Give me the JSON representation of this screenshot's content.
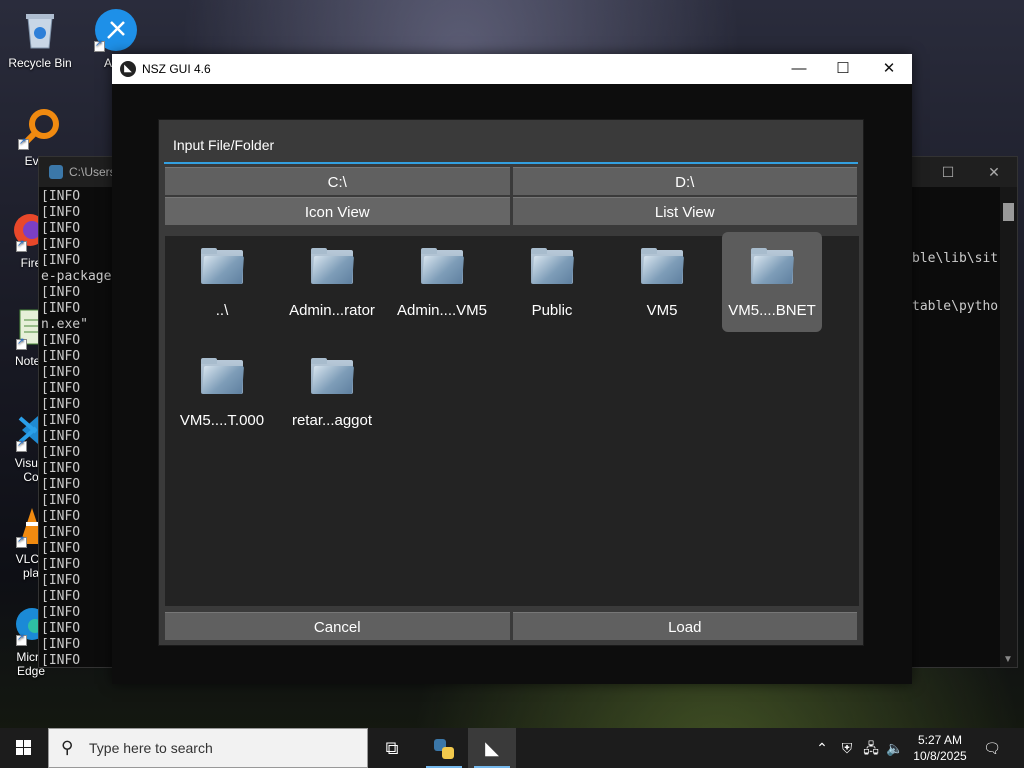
{
  "desktop": {
    "icons": [
      {
        "label": "Recycle Bin"
      },
      {
        "label": "Audi"
      },
      {
        "label": "Every"
      },
      {
        "label": "Fire"
      },
      {
        "label": "Notep"
      },
      {
        "label": "Visual\nCo"
      },
      {
        "label": "VLC r\npla"
      },
      {
        "label": "Micro\nEdge"
      }
    ]
  },
  "console": {
    "title": "C:\\Users",
    "lines": [
      "[INFO    ]",
      "[INFO    ]",
      "[INFO    ]",
      "[INFO    ]",
      "[INFO    ]",
      "e-package",
      "[INFO    ]",
      "[INFO    ]",
      "n.exe\"",
      "[INFO    ]",
      "[INFO    ]",
      "[INFO    ]",
      "[INFO    ]",
      "[INFO    ]",
      "[INFO    ]",
      "[INFO    ]",
      "[INFO    ]",
      "[INFO    ]",
      "[INFO    ]",
      "[INFO    ]",
      "[INFO    ]",
      "[INFO    ]",
      "[INFO    ]",
      "[INFO    ]",
      "[INFO    ]",
      "[INFO    ]",
      "[INFO    ]",
      "[INFO    ]",
      "[INFO    ]",
      "[INFO    ]"
    ],
    "right_line_1": "ble\\lib\\sit",
    "right_line_2": "table\\pytho"
  },
  "window": {
    "title": "NSZ GUI 4.6",
    "minimize": "—",
    "maximize": "☐",
    "close": "✕"
  },
  "dialog": {
    "title": "Input File/Folder",
    "drives": [
      "C:\\",
      "D:\\"
    ],
    "views": [
      "Icon View",
      "List View"
    ],
    "items": [
      {
        "label": "..\\",
        "selected": false
      },
      {
        "label": "Admin...rator",
        "selected": false
      },
      {
        "label": "Admin....VM5",
        "selected": false
      },
      {
        "label": "Public",
        "selected": false
      },
      {
        "label": "VM5",
        "selected": false
      },
      {
        "label": "VM5....BNET",
        "selected": true
      },
      {
        "label": "VM5....T.000",
        "selected": false
      },
      {
        "label": "retar...aggot",
        "selected": false
      }
    ],
    "cancel_label": "Cancel",
    "load_label": "Load"
  },
  "taskbar": {
    "search_placeholder": "Type here to search",
    "time": "5:27 AM",
    "date": "10/8/2025"
  },
  "colors": {
    "accent_line": "#33a0e0",
    "dialog_bg": "#3a3a3a",
    "button_bg": "#606060",
    "selected_item_bg": "#5c5c5c"
  }
}
